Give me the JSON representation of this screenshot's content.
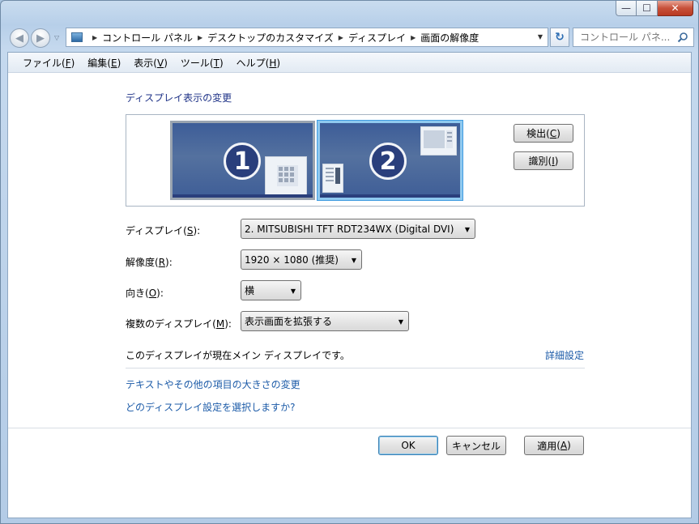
{
  "window": {
    "caption_buttons": {
      "min": "—",
      "max": "☐",
      "close": "✕"
    }
  },
  "nav": {
    "back_glyph": "◀",
    "forward_glyph": "▶",
    "breadcrumb": [
      "コントロール パネル",
      "デスクトップのカスタマイズ",
      "ディスプレイ",
      "画面の解像度"
    ],
    "search_placeholder": "コントロール パネ..."
  },
  "menu": [
    {
      "label": "ファイル",
      "key": "F"
    },
    {
      "label": "編集",
      "key": "E"
    },
    {
      "label": "表示",
      "key": "V"
    },
    {
      "label": "ツール",
      "key": "T"
    },
    {
      "label": "ヘルプ",
      "key": "H"
    }
  ],
  "section_title": "ディスプレイ表示の変更",
  "monitors": [
    {
      "number": "1"
    },
    {
      "number": "2"
    }
  ],
  "buttons": {
    "detect": {
      "label": "検出",
      "key": "C"
    },
    "identify": {
      "label": "識別",
      "key": "I"
    },
    "ok": "OK",
    "cancel": "キャンセル",
    "apply": {
      "label": "適用",
      "key": "A"
    }
  },
  "fields": {
    "display": {
      "label": "ディスプレイ",
      "key": "S",
      "value": "2. MITSUBISHI TFT RDT234WX (Digital DVI)"
    },
    "resolution": {
      "label": "解像度",
      "key": "R",
      "value": "1920 × 1080 (推奨)"
    },
    "orientation": {
      "label": "向き",
      "key": "O",
      "value": "横"
    },
    "multiple": {
      "label": "複数のディスプレイ",
      "key": "M",
      "value": "表示画面を拡張する"
    }
  },
  "info_text": "このディスプレイが現在メイン ディスプレイです。",
  "links": {
    "advanced": "詳細設定",
    "text_size": "テキストやその他の項目の大きさの変更",
    "which_settings": "どのディスプレイ設定を選択しますか?"
  },
  "colors": {
    "link": "#1c5ba8",
    "title": "#1e3287",
    "monitor": "#4a6aa0",
    "selected_border": "#3f9be0"
  }
}
